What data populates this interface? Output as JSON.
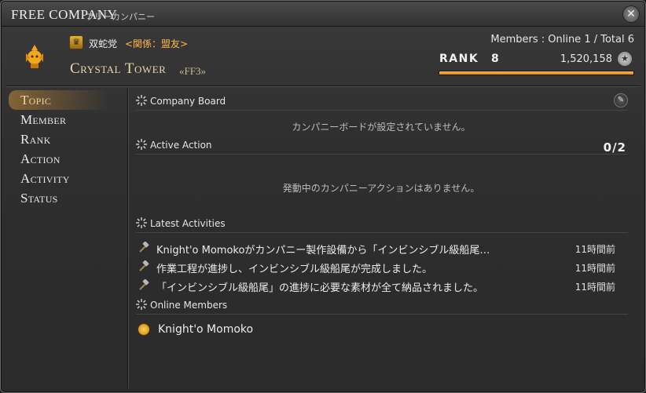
{
  "window": {
    "title_en": "FREE COMPANY",
    "title_jp": "フリーカンパニー",
    "close_icon": "close-x-icon"
  },
  "header": {
    "grand_company": "双蛇党",
    "relation": "<関係：盟友>",
    "fc_name": "Crystal Tower",
    "fc_tag": "«FF3»",
    "members_line": "Members : Online 1 / Total 6",
    "rank_label": "RANK",
    "rank_value": "8",
    "points": "1,520,158",
    "rank_progress": 1.0,
    "crest_icon": "company-crest-icon",
    "gc_icon": "grand-company-icon",
    "points_icon": "company-credits-icon",
    "accent_color": "#f0a020"
  },
  "nav": {
    "items": [
      {
        "label": "Topic",
        "active": true
      },
      {
        "label": "Member",
        "active": false
      },
      {
        "label": "Rank",
        "active": false
      },
      {
        "label": "Action",
        "active": false
      },
      {
        "label": "Activity",
        "active": false
      },
      {
        "label": "Status",
        "active": false
      }
    ]
  },
  "sections": {
    "board": {
      "title": "Company Board",
      "empty": "カンパニーボードが設定されていません。"
    },
    "action": {
      "title": "Active Action",
      "count": "0/2",
      "empty": "発動中のカンパニーアクションはありません。"
    },
    "activities": {
      "title": "Latest Activities",
      "items": [
        {
          "text": "Knight'o Momokoがカンパニー製作設備から「インビンシブル級船尾…",
          "time": "11時間前"
        },
        {
          "text": "作業工程が進捗し、インビンシブル級船尾が完成しました。",
          "time": "11時間前"
        },
        {
          "text": "「インビンシブル級船尾」の進捗に必要な素材が全て納品されました。",
          "time": "11時間前"
        }
      ]
    },
    "online": {
      "title": "Online Members",
      "members": [
        {
          "name": "Knight'o Momoko"
        }
      ]
    }
  }
}
